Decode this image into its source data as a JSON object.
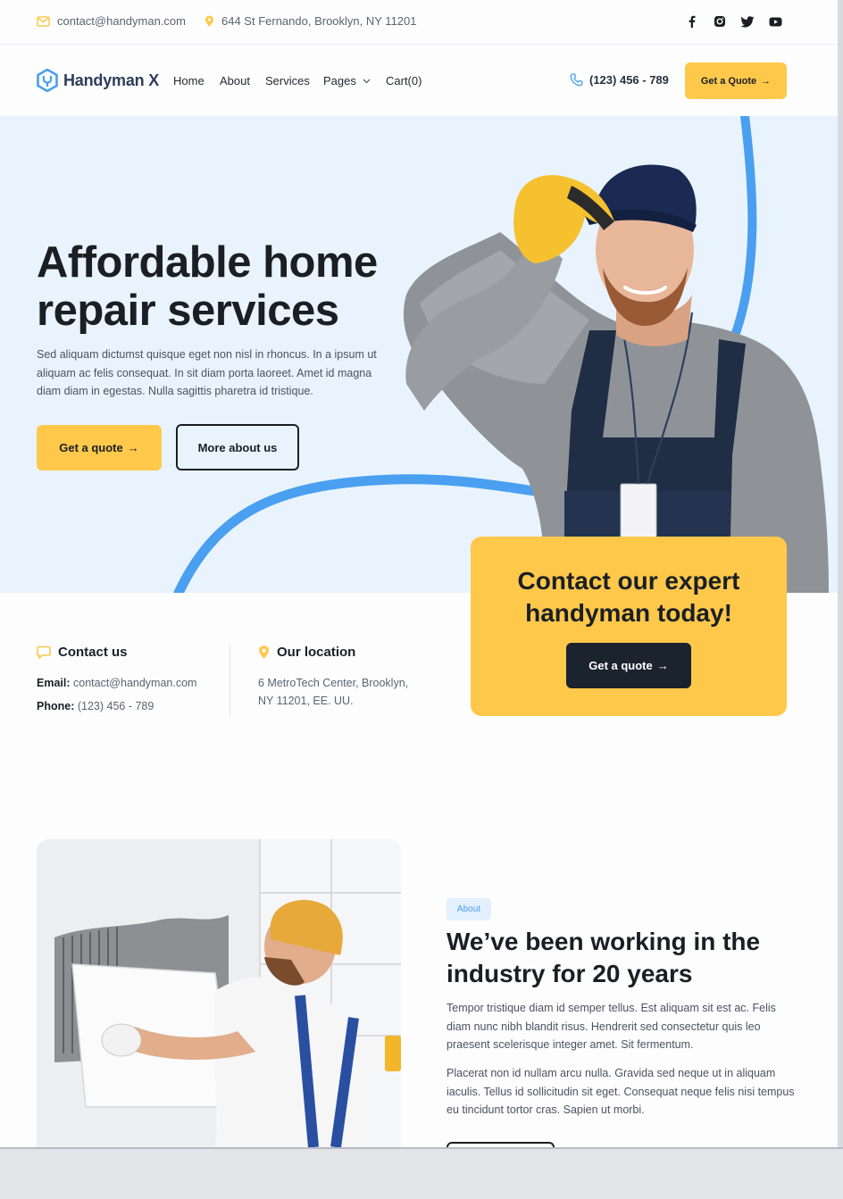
{
  "topbar": {
    "email": "contact@handyman.com",
    "address": "644 St Fernando, Brooklyn, NY 11201",
    "social_icons": [
      "facebook-icon",
      "instagram-icon",
      "twitter-icon",
      "youtube-icon"
    ]
  },
  "nav": {
    "brand": "Handyman X",
    "links": [
      "Home",
      "About",
      "Services",
      "Pages",
      "Cart(0)"
    ],
    "phone": "(123) 456 - 789",
    "quote_label": "Get a Quote"
  },
  "hero": {
    "title": "Affordable home repair services",
    "text": "Sed aliquam dictumst quisque eget non nisl in rhoncus. In a ipsum ut aliquam ac felis consequat. In sit diam porta laoreet. Amet id magna diam diam in egestas. Nulla sagittis pharetra id tristique.",
    "primary_label": "Get a quote",
    "secondary_label": "More about us"
  },
  "cta_card": {
    "title": "Contact our expert handyman today!",
    "button_label": "Get a quote"
  },
  "contact": {
    "heading": "Contact us",
    "email_label": "Email:",
    "email_value": "contact@handyman.com",
    "phone_label": "Phone:",
    "phone_value": "(123) 456 - 789"
  },
  "location": {
    "heading": "Our location",
    "line1": "6 MetroTech Center, Brooklyn,",
    "line2": "NY 11201, EE. UU."
  },
  "about": {
    "badge": "About",
    "title": "We’ve been working in the industry for 20 years",
    "p1": "Tempor tristique diam id semper tellus. Est aliquam sit est ac. Felis diam nunc nibh blandit risus. Hendrerit sed consectetur quis leo praesent scelerisque integer amet. Sit fermentum.",
    "p2": "Placerat non id nullam arcu nulla. Gravida sed neque ut in aliquam iaculis. Tellus id sollicitudin sit eget. Consequat neque felis nisi tempus eu tincidunt tortor cras. Sapien ut morbi."
  },
  "colors": {
    "accent_yellow": "#fec84b",
    "accent_blue": "#4a9ff0",
    "hero_bg": "#e9f3fd",
    "dark": "#1b232e"
  }
}
